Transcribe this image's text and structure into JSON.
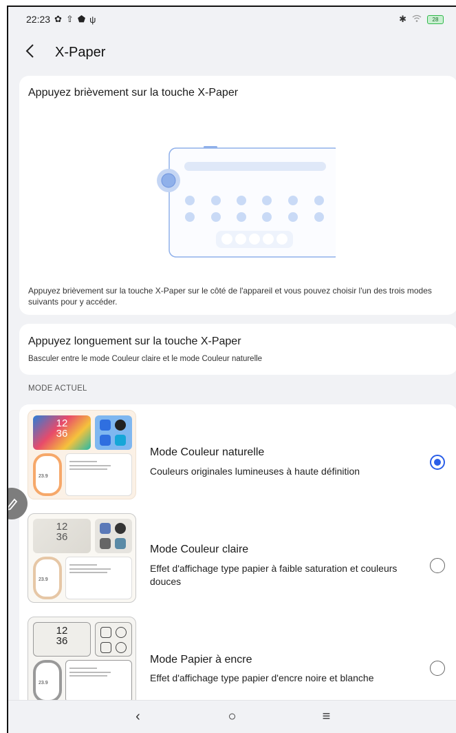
{
  "status_bar": {
    "time": "22:23",
    "left_icons": [
      "settings-icon",
      "upload-icon",
      "shield-icon",
      "usb-icon"
    ],
    "right_icons": [
      "bluetooth-icon",
      "wifi-icon",
      "battery-icon"
    ],
    "battery": "28"
  },
  "app_bar": {
    "back_glyph": "‹",
    "title": "X-Paper"
  },
  "short_press": {
    "title": "Appuyez brièvement sur la touche X-Paper",
    "description": "Appuyez brièvement sur la touche X-Paper sur le côté de l'appareil et vous pouvez choisir l'un des trois modes suivants pour y accéder."
  },
  "long_press": {
    "title": "Appuyez longuement sur la touche X-Paper",
    "subtitle": "Basculer entre le mode Couleur claire et le mode Couleur naturelle"
  },
  "current_mode": {
    "section_label": "MODE ACTUEL",
    "modes": [
      {
        "name": "Mode Couleur naturelle",
        "description": "Couleurs originales lumineuses à haute définition",
        "selected": true,
        "thumb_clock": "12\n36",
        "thumb_temp": "23.9"
      },
      {
        "name": "Mode Couleur claire",
        "description": "Effet d'affichage type papier à faible saturation et couleurs douces",
        "selected": false,
        "thumb_clock": "12\n36",
        "thumb_temp": "23.9"
      },
      {
        "name": "Mode Papier à encre",
        "description": "Effet d'affichage type papier d'encre noire et blanche",
        "selected": false,
        "thumb_clock": "12\n36",
        "thumb_temp": "23.9"
      }
    ]
  },
  "nav_bar": {
    "back": "‹",
    "home": "○",
    "recents": "≡"
  },
  "colors": {
    "accent": "#2a5ee8",
    "background": "#f1f2f5",
    "card": "#ffffff",
    "illustration": "#8fb0ea"
  }
}
